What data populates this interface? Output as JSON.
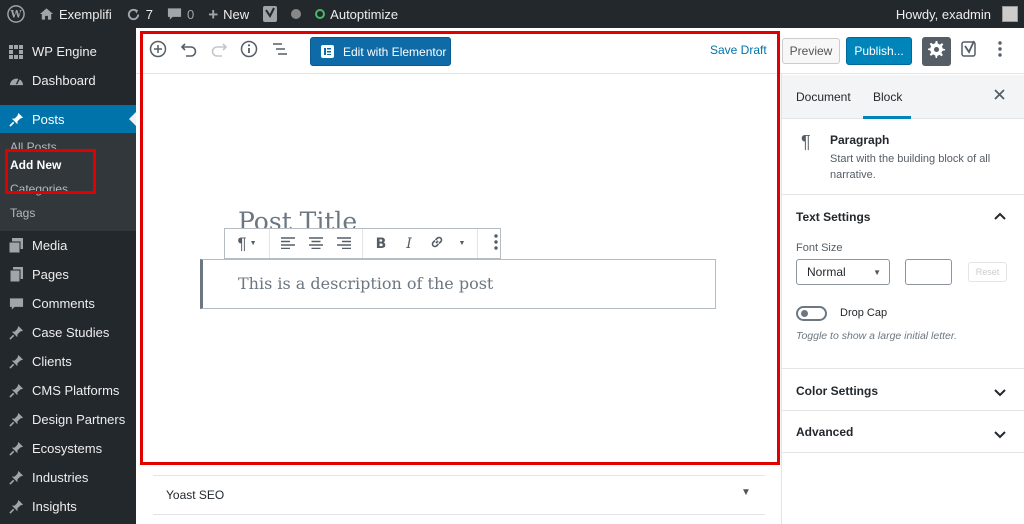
{
  "admin_bar": {
    "site_name": "Exemplifi",
    "updates_count": "7",
    "comments_count": "0",
    "new_label": "New",
    "autoptimize_label": "Autoptimize",
    "greeting": "Howdy, exadmin"
  },
  "sidebar": {
    "items_top": [
      {
        "label": "WP Engine",
        "icon": "wp-engine-icon"
      },
      {
        "label": "Dashboard",
        "icon": "dashboard-icon"
      }
    ],
    "active_item": {
      "label": "Posts",
      "icon": "pin-icon"
    },
    "submenu": [
      {
        "label": "All Posts"
      },
      {
        "label": "Add New"
      },
      {
        "label": "Categories"
      },
      {
        "label": "Tags"
      }
    ],
    "items_bottom": [
      {
        "label": "Media",
        "icon": "media-icon"
      },
      {
        "label": "Pages",
        "icon": "pages-icon"
      },
      {
        "label": "Comments",
        "icon": "comments-icon"
      },
      {
        "label": "Case Studies",
        "icon": "pin-icon"
      },
      {
        "label": "Clients",
        "icon": "pin-icon"
      },
      {
        "label": "CMS Platforms",
        "icon": "pin-icon"
      },
      {
        "label": "Design Partners",
        "icon": "pin-icon"
      },
      {
        "label": "Ecosystems",
        "icon": "pin-icon"
      },
      {
        "label": "Industries",
        "icon": "pin-icon"
      },
      {
        "label": "Insights",
        "icon": "pin-icon"
      }
    ]
  },
  "editor": {
    "elementor_label": "Edit with Elementor",
    "save_draft": "Save Draft",
    "preview": "Preview",
    "publish": "Publish...",
    "post_title": "Post Title",
    "paragraph_text": "This is a description of the post",
    "yoast_label": "Yoast SEO"
  },
  "settings_panel": {
    "tabs": [
      "Document",
      "Block"
    ],
    "active_tab": "Block",
    "block_name": "Paragraph",
    "block_description": "Start with the building block of all narrative.",
    "text_settings": "Text Settings",
    "font_size_label": "Font Size",
    "font_size_value": "Normal",
    "reset_label": "Reset",
    "drop_cap_label": "Drop Cap",
    "drop_cap_help": "Toggle to show a large initial letter.",
    "color_settings": "Color Settings",
    "advanced": "Advanced"
  },
  "colors": {
    "admin_dark": "#23282d",
    "accent_blue": "#0073aa",
    "highlight_red": "#e00000",
    "elementor_blue": "#0e6ba8"
  }
}
